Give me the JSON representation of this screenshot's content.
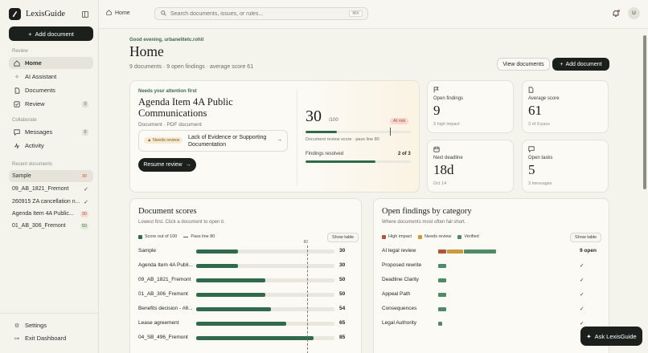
{
  "app": {
    "name": "LexisGuide"
  },
  "sidebar": {
    "add_label": "Add document",
    "sections": {
      "review": "Review",
      "collaborate": "Collaborate",
      "recent": "Recent documents"
    },
    "nav": [
      {
        "label": "Home",
        "icon": "home-icon"
      },
      {
        "label": "AI Assistant",
        "icon": "sparkle-icon"
      },
      {
        "label": "Documents",
        "icon": "document-icon"
      },
      {
        "label": "Review",
        "icon": "review-icon",
        "badge": "9"
      },
      {
        "label": "Messages",
        "icon": "message-icon",
        "badge": "5"
      },
      {
        "label": "Activity",
        "icon": "activity-icon"
      }
    ],
    "recent": [
      {
        "label": "Sample",
        "score": "30"
      },
      {
        "label": "09_AB_1821_Fremont",
        "score": "✓"
      },
      {
        "label": "260915 ZA cancellation n...",
        "score": "✓"
      },
      {
        "label": "Agenda Item 4A Public...",
        "score": "30"
      },
      {
        "label": "01_AB_306_Fremont",
        "score": "50"
      }
    ],
    "settings": "Settings",
    "exit": "Exit Dashboard"
  },
  "topbar": {
    "breadcrumb": "Home",
    "search_placeholder": "Search documents, issues, or rules...",
    "shortcut": "⌘K",
    "avatar": "U"
  },
  "header": {
    "greeting": "Good evening, urbanelitetc.rohit",
    "title": "Home",
    "summary": "9 documents · 9 open findings · average score 61",
    "view_label": "View documents",
    "add_label": "Add document"
  },
  "attention": {
    "label": "Needs your attention first",
    "title": "Agenda Item 4A Public Communications",
    "subtitle": "Document · PDF document",
    "issue_status": "Needs review",
    "issue_text": "Lack of Evidence or Supporting Documentation",
    "resume_label": "Resume review",
    "score": "30",
    "score_of": "/100",
    "risk": "At risk",
    "score_fraction": 0.3,
    "pass_fraction": 0.8,
    "pass_text": "Document review score · pass line 80",
    "findings_label": "Findings resolved",
    "findings_value": "2 of 3",
    "findings_fraction": 0.667
  },
  "stats": [
    {
      "icon": "flag-icon",
      "label": "Open findings",
      "value": "9",
      "sub": "3 high impact"
    },
    {
      "icon": "document-icon",
      "label": "Average score",
      "value": "61",
      "sub": "3 of 9 pass"
    },
    {
      "icon": "calendar-icon",
      "label": "Next deadline",
      "value": "18d",
      "sub": "Oct 14"
    },
    {
      "icon": "chat-icon",
      "label": "Open tasks",
      "value": "5",
      "sub": "3 messages"
    }
  ],
  "scores_panel": {
    "title": "Document scores",
    "subtitle": "Lowest first. Click a document to open it.",
    "legend_score": "Score out of 100",
    "legend_pass": "Pass line 80",
    "show_table": "Show table",
    "pass_value": "80",
    "color": "#2f6b4a"
  },
  "categories_panel": {
    "title": "Open findings by category",
    "subtitle": "Where documents most often fail short.",
    "legend": [
      {
        "label": "High impact",
        "color": "#b5533a"
      },
      {
        "label": "Needs review",
        "color": "#c99a3f"
      },
      {
        "label": "Verified",
        "color": "#4f8a66"
      }
    ],
    "show_table": "Show table"
  },
  "chart_data": [
    {
      "type": "bar",
      "title": "Document scores",
      "categories": [
        "Sample",
        "Agenda Item 4A Publi...",
        "09_AB_1821_Fremont",
        "01_AB_306_Fremont",
        "Benefits decision - #8...",
        "Lease agreement",
        "04_SB_496_Fremont"
      ],
      "values": [
        30,
        30,
        50,
        50,
        54,
        65,
        85
      ],
      "ylim": [
        0,
        100
      ],
      "pass_line": 80
    },
    {
      "type": "bar",
      "title": "Open findings by category",
      "categories": [
        "AI legal review",
        "Proposed rewrite",
        "Deadline Clarity",
        "Appeal Path",
        "Consequences",
        "Legal Authority"
      ],
      "series": [
        {
          "name": "High impact",
          "values": [
            1,
            0,
            0,
            0,
            0,
            0
          ]
        },
        {
          "name": "Needs review",
          "values": [
            2,
            0,
            0,
            0,
            0,
            0
          ]
        },
        {
          "name": "Verified",
          "values": [
            4,
            1,
            1,
            1,
            1,
            0.5
          ]
        }
      ],
      "value_labels": [
        "9 open",
        "✓",
        "✓",
        "✓",
        "✓",
        "✓"
      ]
    }
  ],
  "ask": {
    "label": "Ask LexisGuide"
  }
}
